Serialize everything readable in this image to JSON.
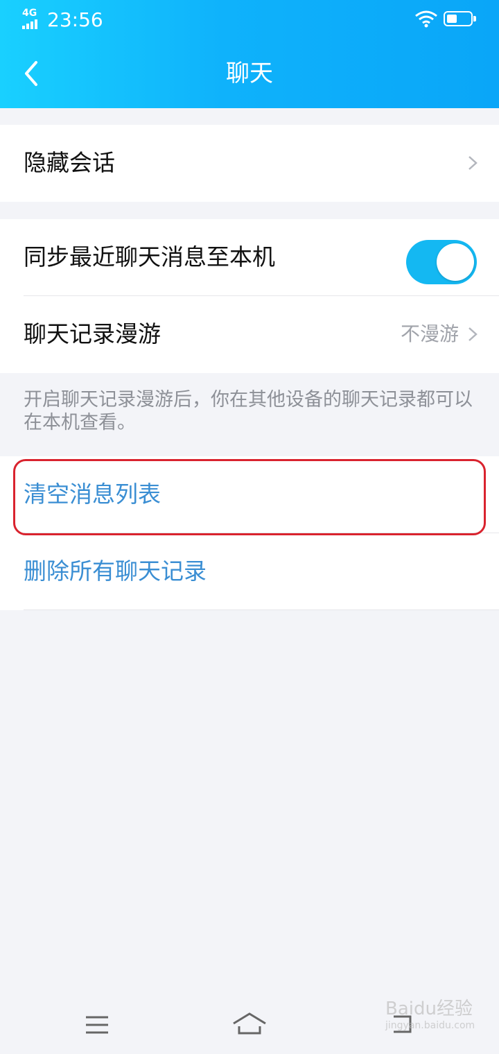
{
  "status_bar": {
    "network": "4G",
    "time": "23:56"
  },
  "header": {
    "title": "聊天"
  },
  "sections": {
    "hidden_chats": {
      "label": "隐藏会话"
    },
    "sync_recent": {
      "label": "同步最近聊天消息至本机",
      "enabled": true
    },
    "roaming": {
      "label": "聊天记录漫游",
      "value": "不漫游"
    },
    "roaming_note": "开启聊天记录漫游后，你在其他设备的聊天记录都可以在本机查看。",
    "clear_list": {
      "label": "清空消息列表"
    },
    "delete_all": {
      "label": "删除所有聊天记录"
    }
  },
  "watermark": {
    "main": "Baidu经验",
    "sub": "jingyan.baidu.com"
  },
  "colors": {
    "header_start": "#19d0ff",
    "header_end": "#0aa6f8",
    "toggle_on": "#14b8f2",
    "action_blue": "#3a8ed3",
    "highlight_red": "#d9232e"
  },
  "icons": [
    "back-arrow-icon",
    "chevron-right-icon",
    "wifi-icon",
    "battery-icon",
    "menu-icon",
    "home-icon",
    "back-nav-icon"
  ]
}
